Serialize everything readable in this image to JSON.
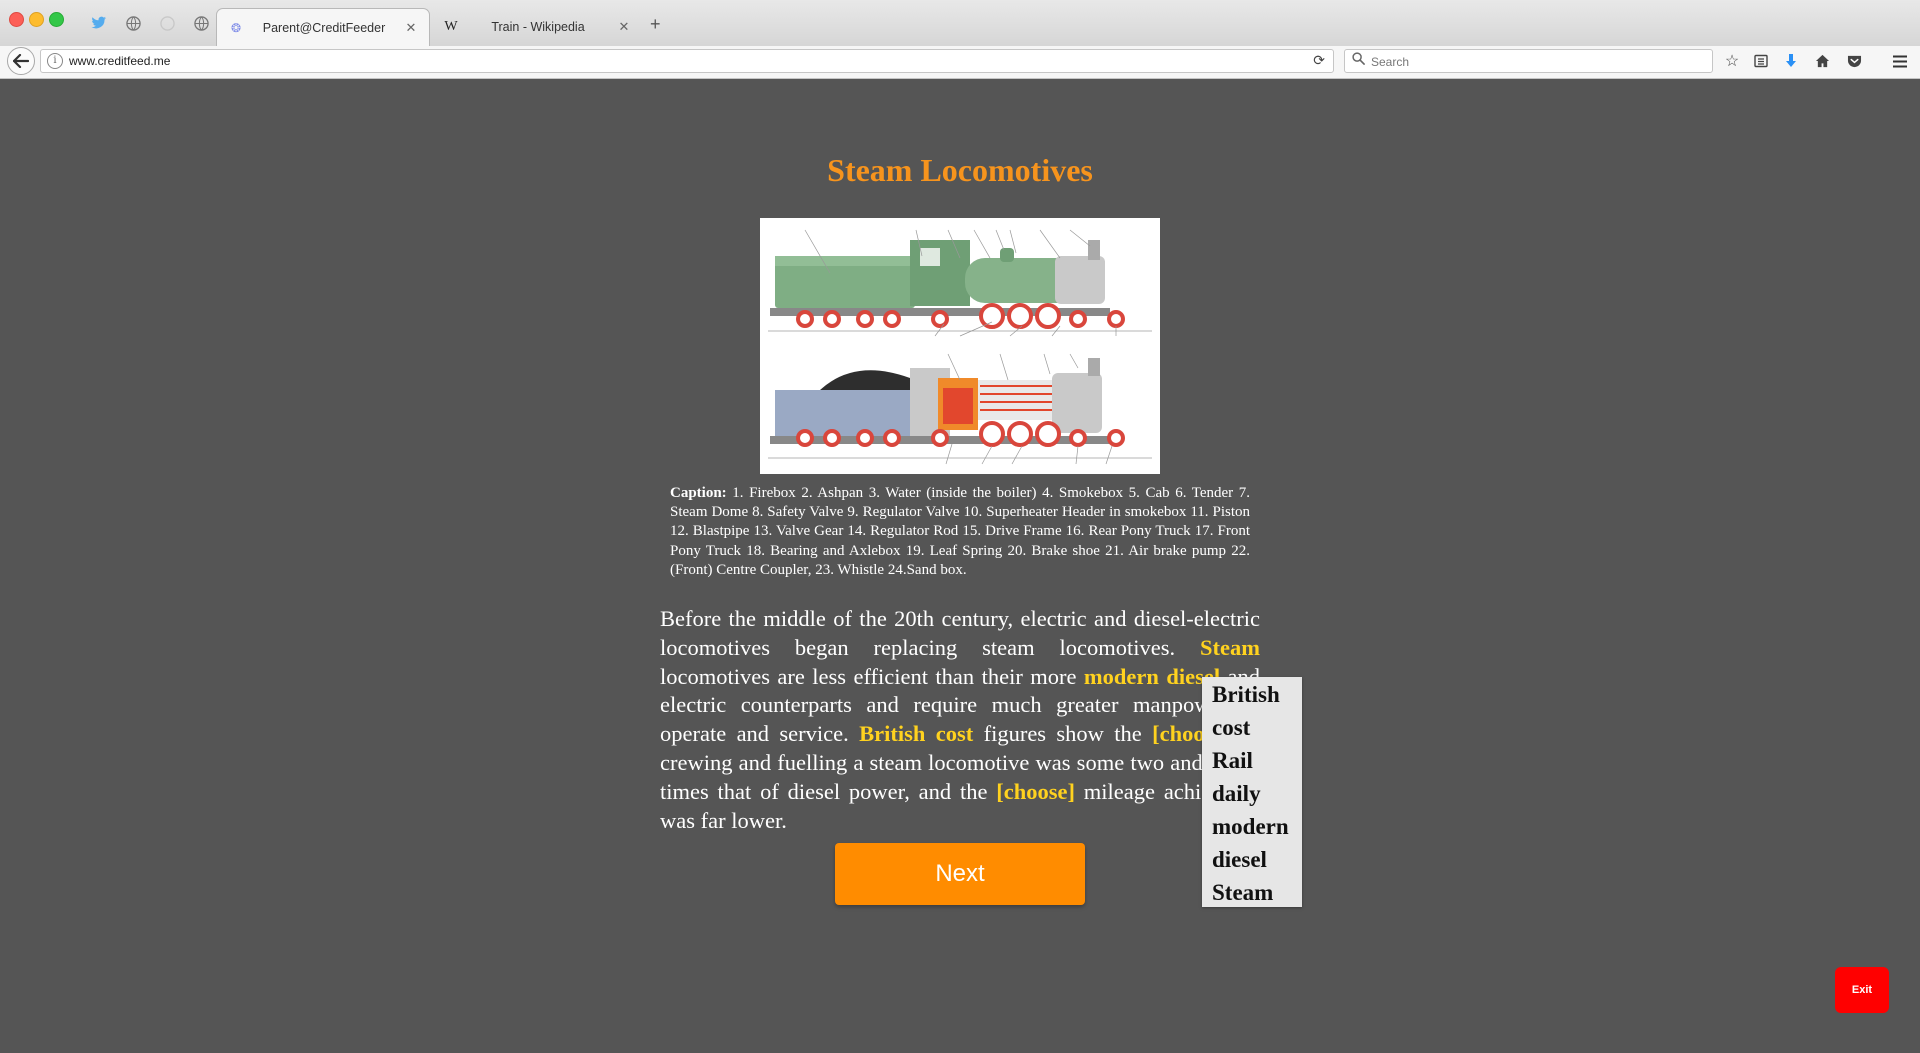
{
  "browser": {
    "tabs": [
      {
        "title": "Parent@CreditFeeder",
        "active": true
      },
      {
        "title": "Train - Wikipedia",
        "active": false
      }
    ],
    "wiki_favicon": "W",
    "url": "www.creditfeed.me",
    "search_placeholder": "Search",
    "icons": [
      "back-icon",
      "info-icon",
      "reload-icon",
      "search-icon",
      "star-icon",
      "reading-list-icon",
      "download-icon",
      "home-icon",
      "pocket-icon",
      "menu-icon",
      "twitter-icon",
      "globe-icon",
      "new-tab-icon"
    ],
    "download_color": "#2a90f5"
  },
  "page": {
    "title": "Steam Locomotives",
    "caption_label": "Caption:",
    "caption_text": "1. Firebox 2. Ashpan 3. Water (inside the boiler) 4. Smokebox 5. Cab 6. Tender 7. Steam Dome 8. Safety Valve 9. Regulator Valve 10. Superheater Header in smokebox 11. Piston 12. Blastpipe 13. Valve Gear 14. Regulator Rod 15. Drive Frame 16. Rear Pony Truck 17. Front Pony Truck 18. Bearing and Axlebox 19. Leaf Spring 20. Brake shoe 21. Air brake pump 22. (Front) Centre Coupler, 23. Whistle 24.Sand box.",
    "paragraph": {
      "p1": "Before the middle of the 20th century, electric and diesel-electric locomotives began replacing steam locomotives. ",
      "w_steam": "Steam",
      "p2": " locomotives are less efficient than their more ",
      "w_modern_diesel": "modern diesel",
      "p3": " and electric counterparts and require much greater manpower to operate and service. ",
      "w_british_cost": "British cost",
      "p4": " figures show the ",
      "blank1": "[choose]",
      "p5": " of crewing and fuelling a steam locomotive was some two and a half times that of diesel power, and the ",
      "blank2": "[choose]",
      "p6": " mileage achievable was far lower."
    },
    "dropdown_options": [
      "British",
      "cost",
      "Rail",
      "daily",
      "modern",
      "diesel",
      "Steam"
    ],
    "next_label": "Next",
    "exit_label": "Exit",
    "colors": {
      "background": "#555555",
      "title": "#f7941d",
      "highlight": "#ffd21f",
      "next_button": "#ff8c00",
      "exit_button": "#ff0000",
      "engine_green": "#7fae84",
      "wheel_red": "#d9463c",
      "firebox_orange": "#f08a2a"
    }
  }
}
